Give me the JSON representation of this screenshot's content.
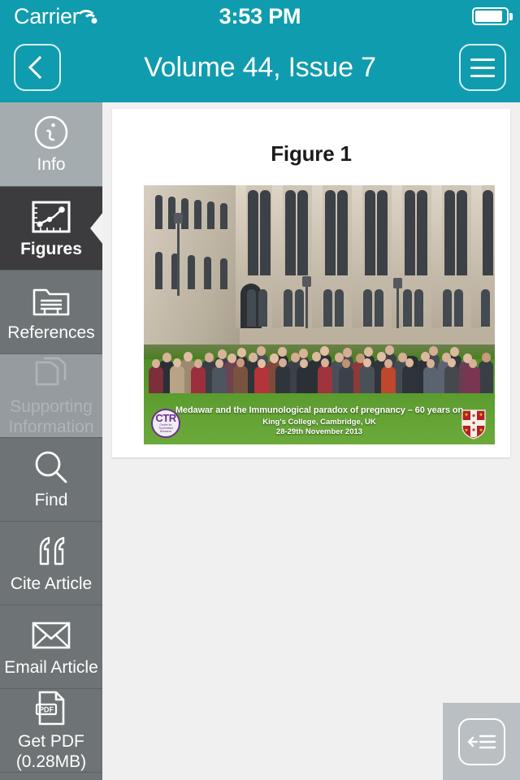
{
  "status_bar": {
    "carrier": "Carrier",
    "wifi_icon": "wifi-icon",
    "time": "3:53 PM",
    "battery_icon": "battery-icon"
  },
  "nav_bar": {
    "back_icon": "chevron-left-icon",
    "title": "Volume 44, Issue 7",
    "menu_icon": "hamburger-menu-icon"
  },
  "sidebar": {
    "items": [
      {
        "id": "info",
        "label": "Info",
        "icon": "info-circle-icon",
        "state": "normal"
      },
      {
        "id": "figures",
        "label": "Figures",
        "icon": "chart-figure-icon",
        "state": "selected"
      },
      {
        "id": "references",
        "label": "References",
        "icon": "folder-document-icon",
        "state": "normal"
      },
      {
        "id": "supporting-information",
        "label": "Supporting Information",
        "icon": "copy-pages-icon",
        "state": "disabled"
      },
      {
        "id": "find",
        "label": "Find",
        "icon": "magnifier-icon",
        "state": "normal"
      },
      {
        "id": "cite-article",
        "label": "Cite Article",
        "icon": "quote-marks-icon",
        "state": "normal"
      },
      {
        "id": "email-article",
        "label": "Email Article",
        "icon": "envelope-icon",
        "state": "normal"
      },
      {
        "id": "get-pdf",
        "label": "Get PDF (0.28MB)",
        "label_line1": "Get PDF",
        "label_line2": "(0.28MB)",
        "icon": "pdf-file-icon",
        "state": "normal"
      }
    ]
  },
  "main": {
    "figure_title": "Figure 1",
    "photo": {
      "alt": "Group photograph of conference attendees in front of King's College Chapel, Cambridge",
      "caption_line1": "Medawar and the Immunological paradox of pregnancy – 60 years on",
      "caption_line2": "King's College, Cambridge, UK",
      "caption_line3": "28-29th November 2013",
      "left_logo": "ctr-logo",
      "left_logo_text": "CTR",
      "left_logo_subtext": "Centre for Trophoblast Research",
      "right_logo": "cambridge-crest-icon"
    }
  },
  "floating_button": {
    "icon": "collapse-sidebar-icon",
    "name": "toggle-sidebar-button"
  },
  "colors": {
    "teal_header": "#0f9cae",
    "sidebar_gray": "#6e7376",
    "sidebar_selected": "#3c3c3e",
    "sidebar_info": "#a4acb0",
    "sidebar_disabled": "#959b9e",
    "page_background": "#f0f0f0",
    "card_background": "#ffffff",
    "fab_background": "#b9bfc2"
  }
}
